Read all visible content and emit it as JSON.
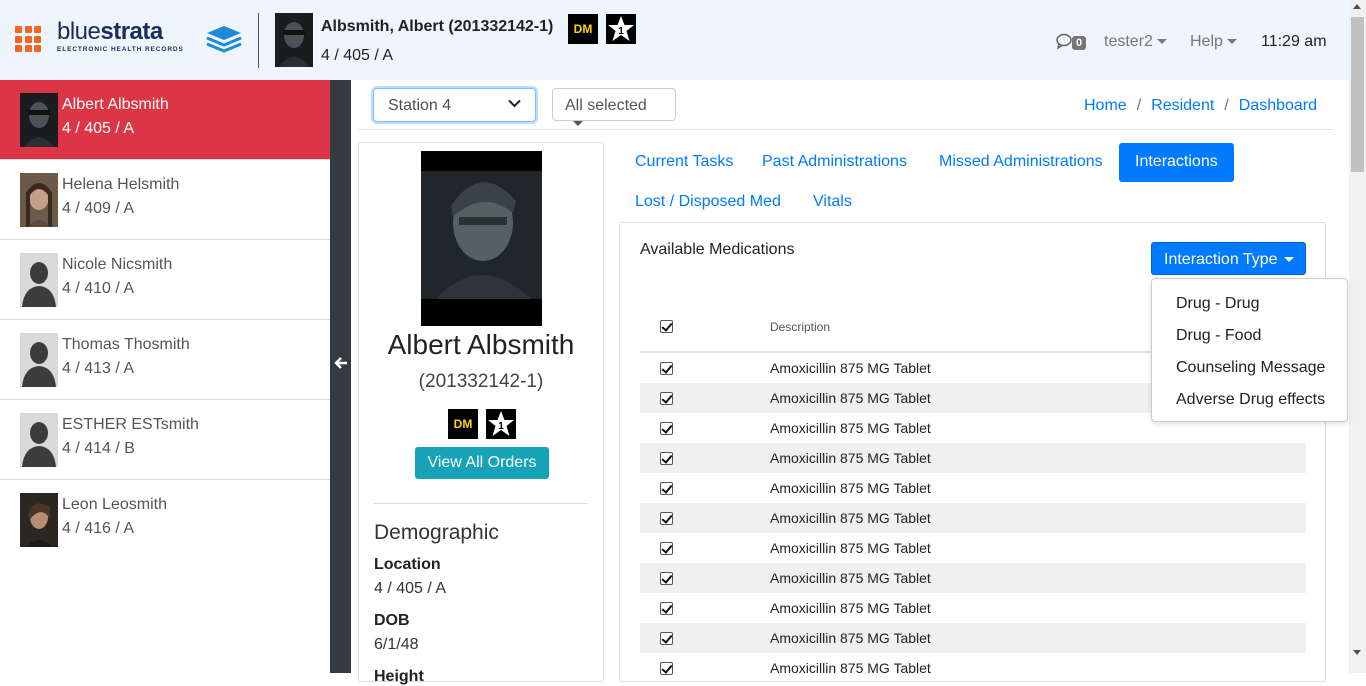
{
  "header": {
    "logo_text_light": "blue",
    "logo_text_bold": "strata",
    "logo_sub": "ELECTRONIC HEALTH RECORDS",
    "patient_name": "Albsmith, Albert (201332142-1)",
    "patient_location": "4 / 405 / A",
    "badge_dm": "DM",
    "badge_star_number": "1",
    "message_count": "0",
    "user": "tester2",
    "help": "Help",
    "time": "11:29 am"
  },
  "sidebar": {
    "residents": [
      {
        "name": "Albert Albsmith",
        "location": "4 / 405 / A",
        "active": true,
        "avatar": "photo-dark"
      },
      {
        "name": "Helena Helsmith",
        "location": "4 / 409 / A",
        "active": false,
        "avatar": "photo-woman"
      },
      {
        "name": "Nicole Nicsmith",
        "location": "4 / 410 / A",
        "active": false,
        "avatar": "silhouette"
      },
      {
        "name": "Thomas Thosmith",
        "location": "4 / 413 / A",
        "active": false,
        "avatar": "silhouette"
      },
      {
        "name": "ESTHER ESTsmith",
        "location": "4 / 414 / B",
        "active": false,
        "avatar": "silhouette"
      },
      {
        "name": "Leon Leosmith",
        "location": "4 / 416 / A",
        "active": false,
        "avatar": "photo-man"
      }
    ]
  },
  "filters": {
    "station": "Station 4",
    "selection": "All selected"
  },
  "breadcrumb": {
    "items": [
      "Home",
      "Resident",
      "Dashboard"
    ],
    "separator": "/"
  },
  "profile": {
    "name": "Albert Albsmith",
    "id": "(201332142-1)",
    "badge_dm": "DM",
    "badge_star_number": "1",
    "view_orders": "View All Orders",
    "demographic_title": "Demographic",
    "fields": [
      {
        "label": "Location",
        "value": "4 / 405 / A"
      },
      {
        "label": "DOB",
        "value": "6/1/48"
      },
      {
        "label": "Height",
        "value": ""
      }
    ]
  },
  "tabs": [
    {
      "label": "Current Tasks",
      "active": false
    },
    {
      "label": "Past Administrations",
      "active": false
    },
    {
      "label": "Missed Administrations",
      "active": false
    },
    {
      "label": "Interactions",
      "active": true
    },
    {
      "label": "Lost / Disposed Med",
      "active": false
    },
    {
      "label": "Vitals",
      "active": false
    }
  ],
  "medications": {
    "title": "Available Medications",
    "interaction_type_label": "Interaction Type",
    "column_description": "Description",
    "rows": [
      "Amoxicillin 875 MG Tablet",
      "Amoxicillin 875 MG Tablet",
      "Amoxicillin 875 MG Tablet",
      "Amoxicillin 875 MG Tablet",
      "Amoxicillin 875 MG Tablet",
      "Amoxicillin 875 MG Tablet",
      "Amoxicillin 875 MG Tablet",
      "Amoxicillin 875 MG Tablet",
      "Amoxicillin 875 MG Tablet",
      "Amoxicillin 875 MG Tablet",
      "Amoxicillin 875 MG Tablet"
    ]
  },
  "interaction_menu": {
    "items": [
      "Drug - Drug",
      "Drug - Food",
      "Counseling Message",
      "Adverse Drug effects"
    ]
  },
  "colors": {
    "brand_orange": "#f26522",
    "primary": "#007bff",
    "active_resident": "#dc3545",
    "teal_button": "#17a2b8",
    "topbar_bg": "#eef5fd"
  }
}
